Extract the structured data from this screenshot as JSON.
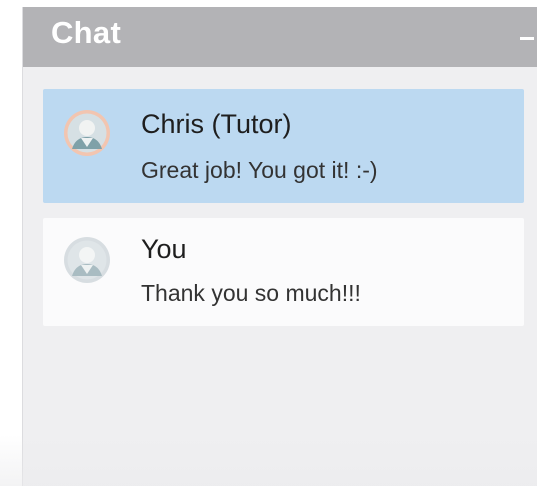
{
  "header": {
    "title": "Chat",
    "minimize_icon": "minimize-icon"
  },
  "messages": [
    {
      "sender": "Chris (Tutor)",
      "text": "Great job! You got it! :-)",
      "highlight_color": "#bcd9f1",
      "avatar_ring_color": "#f3c7b2"
    },
    {
      "sender": "You",
      "text": "Thank you so much!!!",
      "highlight_color": "#fbfbfc",
      "avatar_ring_color": "#d8dde1"
    }
  ],
  "colors": {
    "header_bg": "#b3b3b6",
    "panel_bg": "#efeff1"
  }
}
